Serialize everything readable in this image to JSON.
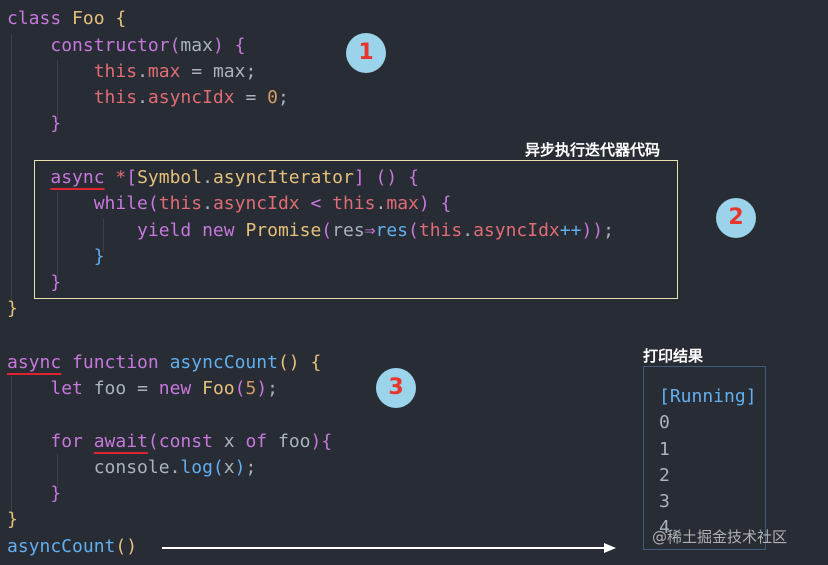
{
  "badges": [
    "1",
    "2",
    "3"
  ],
  "notes": {
    "async_iterator": "异步执行迭代器代码",
    "output_title": "打印结果"
  },
  "code": {
    "class_kw": "class",
    "class_name": "Foo",
    "constructor": "constructor",
    "param_max": "max",
    "this1": "this",
    "max_prop": "max",
    "max_val": "max",
    "this2": "this",
    "async_idx_prop": "asyncIdx",
    "zero": "0",
    "async_kw": "async",
    "symbol": "Symbol",
    "async_iterator": "asyncIterator",
    "while_kw": "while",
    "this3": "this",
    "async_idx_2": "asyncIdx",
    "this4": "this",
    "max_2": "max",
    "yield_kw": "yield",
    "new_kw": "new",
    "promise": "Promise",
    "res1": "res",
    "arrow": "⇒",
    "res2": "res",
    "this5": "this",
    "async_idx_3": "asyncIdx",
    "inc": "++",
    "async_kw2": "async",
    "function_kw": "function",
    "fn_name": "asyncCount",
    "let_kw": "let",
    "foo_var": "foo",
    "new_kw2": "new",
    "foo_cls": "Foo",
    "five": "5",
    "for_kw": "for",
    "await_kw": "await",
    "const_kw": "const",
    "x_var": "x",
    "of_kw": "of",
    "foo_var2": "foo",
    "console": "console",
    "log": "log",
    "x_var2": "x",
    "call_name": "asyncCount"
  },
  "output": {
    "running": "[Running]",
    "values": [
      "0",
      "1",
      "2",
      "3",
      "4"
    ]
  },
  "watermark": "@稀土掘金技术社区",
  "colors": {
    "background": "#282c34",
    "keyword": "#c678dd",
    "class": "#e5c07b",
    "function": "#61afef",
    "property": "#e06c75",
    "number": "#d19a66",
    "badge_bg": "#9bd3eb",
    "badge_text": "#e8352e",
    "underline": "#e0242f"
  }
}
